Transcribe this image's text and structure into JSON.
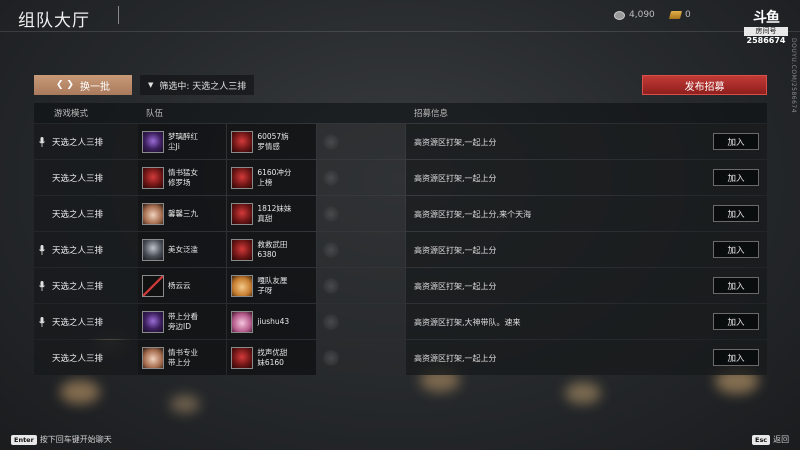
{
  "header": {
    "title": "组队大厅",
    "coin_amount": "4,090",
    "gold_amount": "0",
    "logo_mark": "斗鱼",
    "logo_room_label": "房间号",
    "logo_room_number": "2586674",
    "side_url": "DOUYU.COM/2586674"
  },
  "toolbar": {
    "refresh_label": "换一批",
    "filter_label": "筛选中: 天选之人三排",
    "publish_label": "发布招募"
  },
  "table": {
    "columns": [
      "游戏模式",
      "队伍",
      "招募信息"
    ],
    "join_label": "加入",
    "rows": [
      {
        "mic": true,
        "mode": "天选之人三排",
        "members": [
          {
            "name": "梦璃醉红\n尘Ji",
            "avatar": "purple"
          },
          {
            "name": "60057旃\n罗情感",
            "avatar": "red"
          }
        ],
        "info": "高资源区打架,一起上分"
      },
      {
        "mic": false,
        "mode": "天选之人三排",
        "members": [
          {
            "name": "情书猛女\n修罗场",
            "avatar": "red"
          },
          {
            "name": "6160冲分\n上榜",
            "avatar": "red"
          }
        ],
        "info": "高资源区打架,一起上分"
      },
      {
        "mic": false,
        "mode": "天选之人三排",
        "members": [
          {
            "name": "馨馨三九",
            "avatar": "face"
          },
          {
            "name": "1812妹妹\n真甜",
            "avatar": "red"
          }
        ],
        "info": "高资源区打架,一起上分,来个天海"
      },
      {
        "mic": true,
        "mode": "天选之人三排",
        "members": [
          {
            "name": "美女泛滥",
            "avatar": "dark"
          },
          {
            "name": "救救武田\n6380",
            "avatar": "red"
          }
        ],
        "info": "高资源区打架,一起上分"
      },
      {
        "mic": true,
        "mode": "天选之人三排",
        "members": [
          {
            "name": "杨云云",
            "avatar": "slash"
          },
          {
            "name": "嘎队友厘\n子呀",
            "avatar": "dog"
          }
        ],
        "info": "高资源区打架,一起上分"
      },
      {
        "mic": true,
        "mode": "天选之人三排",
        "members": [
          {
            "name": "带上分看\n旁边ID",
            "avatar": "purple"
          },
          {
            "name": "jiushu43",
            "avatar": "pink"
          }
        ],
        "info": "高资源区打架,大神带队。速来"
      },
      {
        "mic": false,
        "mode": "天选之人三排",
        "members": [
          {
            "name": "情书专业\n带上分",
            "avatar": "face"
          },
          {
            "name": "找声优甜\n妹6160",
            "avatar": "red"
          }
        ],
        "info": "高资源区打架,一起上分"
      }
    ]
  },
  "footer": {
    "enter_key": "Enter",
    "enter_hint": "按下回车键开始聊天",
    "esc_key": "Esc",
    "esc_hint": "返回"
  }
}
